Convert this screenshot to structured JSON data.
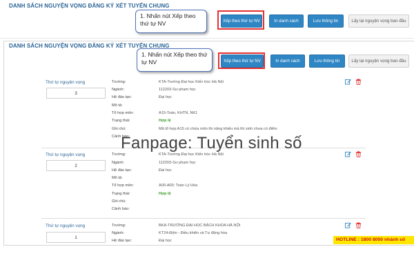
{
  "top_strip": {
    "title": "DANH SÁCH NGUYỆN VỌNG ĐĂNG KÝ XÉT TUYỂN CHUNG",
    "callout": "1. Nhấn nút Xếp theo thứ tự NV",
    "buttons": {
      "sort": "Xếp theo thứ tự NV",
      "print": "In danh sách",
      "save": "Lưu thông tin",
      "restore": "Lấy lại nguyện vọng ban đầu"
    }
  },
  "main": {
    "title": "DANH SÁCH NGUYỆN VỌNG ĐĂNG KÝ XÉT TUYỂN CHUNG",
    "callout": "1. Nhấn nút Xếp theo thứ tự NV",
    "buttons": {
      "sort": "Xếp theo thứ tự NV",
      "print": "In danh sách",
      "save": "Lưu thông tin",
      "restore": "Lấy lại nguyện vọng ban đầu"
    },
    "labels": {
      "order": "Thứ tự nguyện vọng",
      "school": "Trường:",
      "major": "Ngành:",
      "training": "Hệ đào tạo:",
      "desc": "Mô tả:",
      "combo": "Tổ hợp môn:",
      "status": "Trạng thái:",
      "note": "Ghi chú:",
      "warning": "Cảnh báo:"
    },
    "wishes": [
      {
        "order": "3",
        "school": "KTA-Trường Đại học Kiến trúc Hà Nội",
        "major": "112203-Sư phạm học",
        "training": "Đại học",
        "combo": "A15-Toán, KHTN, NK1",
        "status": "Hợp lệ",
        "note": "Mã tổ hợp A15 có chứa môn thi năng khiếu mà thí sinh chưa có điểm"
      },
      {
        "order": "2",
        "school": "KTA-Trường Đại học Kiến trúc Hà Nội",
        "major": "112203-Sư phạm học",
        "training": "Đại học",
        "combo": "A00-A00: Toán Lý Hóa",
        "status": "Hợp lệ",
        "note": ""
      },
      {
        "order": "1",
        "school": "BKA-TRƯỜNG ĐẠI HỌC BÁCH KHOA HÀ NỘI",
        "major": "KT24-Điện - Điều khiển và Tự động hóa",
        "training": "Đại học"
      }
    ]
  },
  "watermark": "Fanpage: Tuyển sinh số",
  "hotline": "HOTLINE : 1800 8000 nhánh số",
  "colors": {
    "accent": "#2f86c4",
    "highlight": "#e53030",
    "valid": "#3a9a2a",
    "hotline_bg": "#ffe600"
  }
}
